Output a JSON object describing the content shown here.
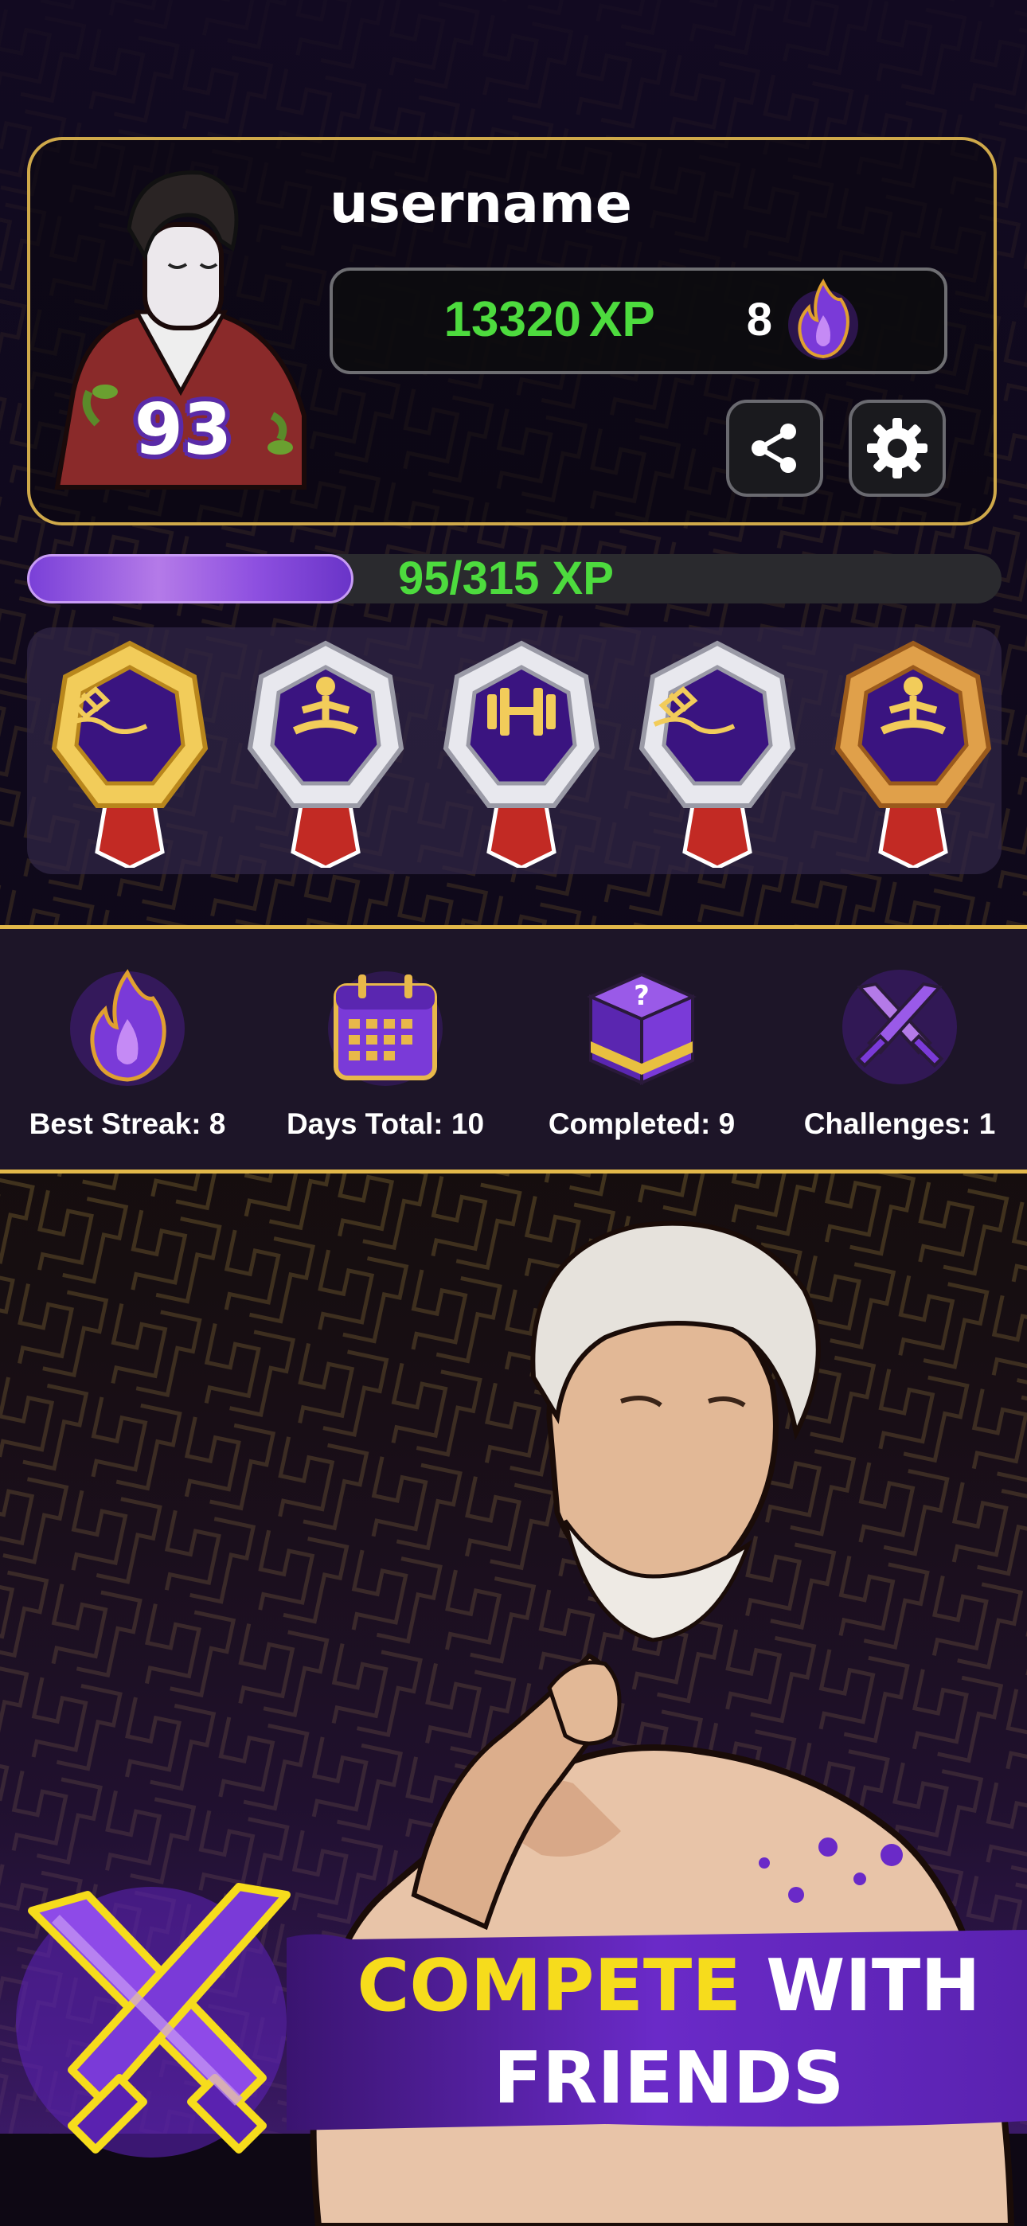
{
  "profile": {
    "username": "username",
    "level": "93",
    "xp_value": "13320",
    "xp_label": "XP",
    "streak_count": "8",
    "streak_icon": "flame-icon",
    "share_icon": "share-icon",
    "settings_icon": "gear-icon"
  },
  "level_progress": {
    "text": "95/315 XP",
    "current": 95,
    "total": 315
  },
  "badges": [
    {
      "icon": "signature-icon",
      "frame": "gold"
    },
    {
      "icon": "meditation-icon",
      "frame": "silver"
    },
    {
      "icon": "dumbbell-icon",
      "frame": "silver"
    },
    {
      "icon": "signature-icon",
      "frame": "silver"
    },
    {
      "icon": "meditation-icon",
      "frame": "bronze"
    }
  ],
  "stats": [
    {
      "icon": "flame-icon",
      "label": "Best Streak: 8"
    },
    {
      "icon": "calendar-icon",
      "label": "Days Total: 10"
    },
    {
      "icon": "mystery-box-icon",
      "label": "Completed: 9"
    },
    {
      "icon": "crossed-swords-icon",
      "label": "Challenges: 1"
    }
  ],
  "promo": {
    "line1_highlight": "COMPETE",
    "line1_rest": " WITH",
    "line2": "FRIENDS"
  },
  "colors": {
    "gold_border": "#cfa94a",
    "xp_green": "#4ddb3e",
    "purple": "#7a3ad8",
    "promo_yellow": "#f6dc1c"
  }
}
